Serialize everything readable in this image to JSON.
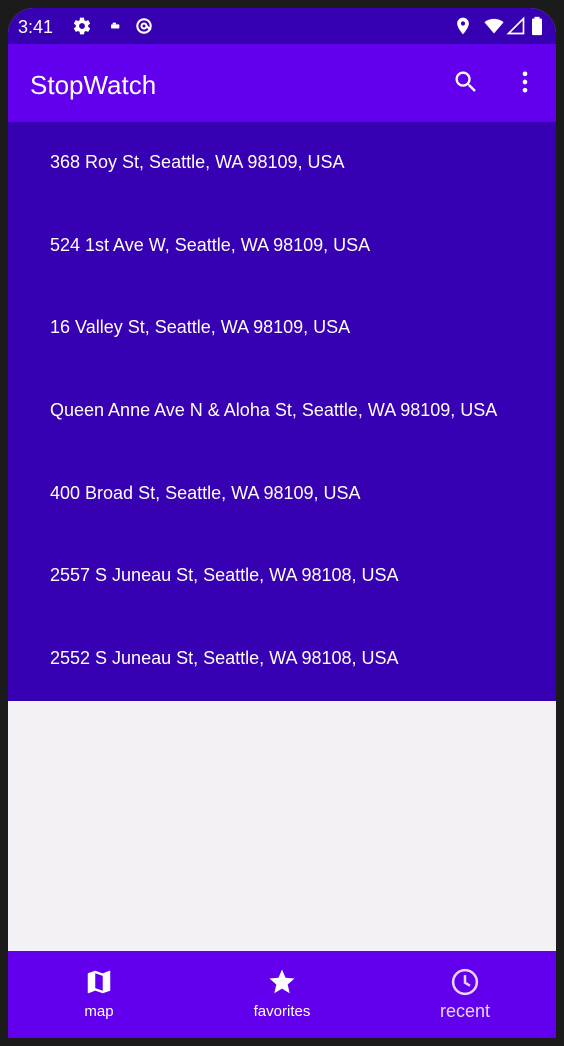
{
  "status_bar": {
    "time": "3:41",
    "left_icons": [
      "settings-icon",
      "sim-icon",
      "at-icon"
    ],
    "right_icons": [
      "location-icon",
      "wifi-icon",
      "signal-icon",
      "battery-icon"
    ]
  },
  "app_bar": {
    "title": "StopWatch",
    "actions": [
      "search-icon",
      "more-vert-icon"
    ]
  },
  "list": {
    "items": [
      {
        "label": "368 Roy St, Seattle, WA 98109, USA"
      },
      {
        "label": "524 1st Ave W, Seattle, WA 98109, USA"
      },
      {
        "label": "16 Valley St, Seattle, WA 98109, USA"
      },
      {
        "label": "Queen Anne Ave N & Aloha St, Seattle, WA 98109, USA"
      },
      {
        "label": "400 Broad St, Seattle, WA 98109, USA"
      },
      {
        "label": "2557 S Juneau St, Seattle, WA 98108, USA"
      },
      {
        "label": "2552 S Juneau St, Seattle, WA 98108, USA"
      }
    ]
  },
  "bottom_nav": {
    "items": [
      {
        "label": "map",
        "icon": "map-icon"
      },
      {
        "label": "favorites",
        "icon": "star-icon"
      },
      {
        "label": "recent",
        "icon": "clock-icon",
        "selected": true
      }
    ]
  },
  "colors": {
    "primary": "#6200ee",
    "primary_dark": "#3700b3",
    "background": "#f3f1f5",
    "on_primary": "#ffffff"
  }
}
